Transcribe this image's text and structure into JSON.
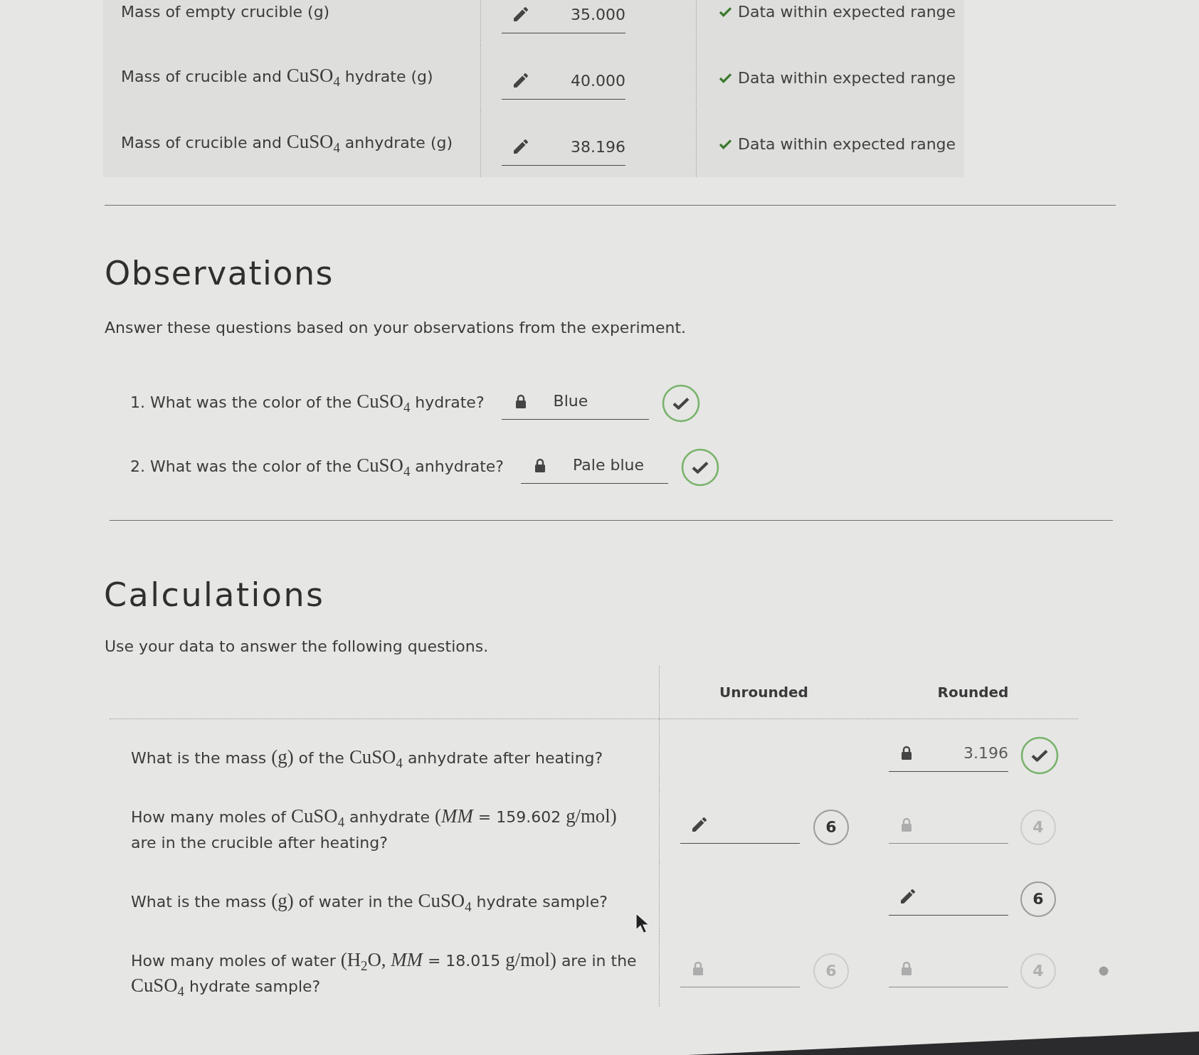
{
  "data_table": {
    "rows": [
      {
        "label": [
          {
            "kind": "text",
            "text": "Mass of empty crucible (g)"
          }
        ],
        "field": {
          "locked": false,
          "value": "35.000"
        },
        "status": {
          "kind": "ok",
          "text": "Data within expected range"
        }
      },
      {
        "label": [
          {
            "kind": "text",
            "text": "Mass of crucible and "
          },
          {
            "kind": "math",
            "text": "CuSO$_{4}$"
          },
          {
            "kind": "text",
            "text": " hydrate (g)"
          }
        ],
        "field": {
          "locked": false,
          "value": "40.000"
        },
        "status": {
          "kind": "ok",
          "text": "Data within expected range"
        }
      },
      {
        "label": [
          {
            "kind": "text",
            "text": "Mass of crucible and "
          },
          {
            "kind": "math",
            "text": "CuSO$_{4}$"
          },
          {
            "kind": "text",
            "text": " anhydrate (g)"
          }
        ],
        "field": {
          "locked": false,
          "value": "38.196"
        },
        "status": {
          "kind": "ok",
          "text": "Data within expected range"
        }
      }
    ]
  },
  "observations": {
    "heading": "Observations",
    "intro": "Answer these questions based on your observations from the experiment.",
    "questions": [
      {
        "number": "1.",
        "text": [
          {
            "kind": "text",
            "text": "What was the color of the "
          },
          {
            "kind": "math",
            "text": "CuSO$_{4}$"
          },
          {
            "kind": "text",
            "text": " hydrate?"
          }
        ],
        "answer": {
          "locked": true,
          "value": "Blue"
        },
        "correct": true
      },
      {
        "number": "2.",
        "text": [
          {
            "kind": "text",
            "text": "What was the color of the "
          },
          {
            "kind": "math",
            "text": "CuSO$_{4}$"
          },
          {
            "kind": "text",
            "text": " anhydrate?"
          }
        ],
        "answer": {
          "locked": true,
          "value": "Pale blue"
        },
        "correct": true
      }
    ]
  },
  "calculations": {
    "heading": "Calculations",
    "intro": "Use your data to answer the following questions.",
    "columns": [
      "Unrounded",
      "Rounded"
    ],
    "rows": [
      {
        "question": [
          {
            "kind": "text",
            "text": "What is the mass "
          },
          {
            "kind": "math",
            "text": "(g)"
          },
          {
            "kind": "text",
            "text": " of the "
          },
          {
            "kind": "math",
            "text": "CuSO$_{4}$"
          },
          {
            "kind": "text",
            "text": " anhydrate after heating?"
          }
        ],
        "rounded": {
          "locked": true,
          "disabled": false,
          "value": "3.196",
          "badge": {
            "kind": "check"
          }
        }
      },
      {
        "question": [
          {
            "kind": "text",
            "text": "How many moles of "
          },
          {
            "kind": "math",
            "text": "CuSO$_{4}$"
          },
          {
            "kind": "text",
            "text": " anhydrate "
          },
          {
            "kind": "math",
            "text": "(*MM*"
          },
          {
            "kind": "text",
            "text": " = 159.602 "
          },
          {
            "kind": "math",
            "text": "g/mol)"
          },
          {
            "kind": "text",
            "text": " are in the crucible after heating?"
          }
        ],
        "unrounded": {
          "locked": false,
          "disabled": false,
          "badge": {
            "kind": "attempts",
            "text": "6"
          }
        },
        "rounded": {
          "locked": true,
          "disabled": true,
          "badge": {
            "kind": "attempts",
            "text": "4"
          }
        }
      },
      {
        "question": [
          {
            "kind": "text",
            "text": "What is the mass "
          },
          {
            "kind": "math",
            "text": "(g)"
          },
          {
            "kind": "text",
            "text": " of water in the "
          },
          {
            "kind": "math",
            "text": "CuSO$_{4}$"
          },
          {
            "kind": "text",
            "text": " hydrate sample?"
          }
        ],
        "rounded": {
          "locked": false,
          "disabled": false,
          "badge": {
            "kind": "attempts",
            "text": "6"
          }
        }
      },
      {
        "question": [
          {
            "kind": "text",
            "text": "How many moles of water "
          },
          {
            "kind": "math",
            "text": "(H$_{2}$O, *MM*"
          },
          {
            "kind": "text",
            "text": " = 18.015 "
          },
          {
            "kind": "math",
            "text": "g/mol)"
          },
          {
            "kind": "text",
            "text": " are in the "
          },
          {
            "kind": "math",
            "text": "CuSO$_{4}$"
          },
          {
            "kind": "text",
            "text": " hydrate sample?"
          }
        ],
        "unrounded": {
          "locked": true,
          "disabled": true,
          "badge": {
            "kind": "attempts",
            "text": "6"
          }
        },
        "rounded": {
          "locked": true,
          "disabled": true,
          "badge": {
            "kind": "attempts",
            "text": "4"
          }
        },
        "dot": true
      }
    ]
  }
}
